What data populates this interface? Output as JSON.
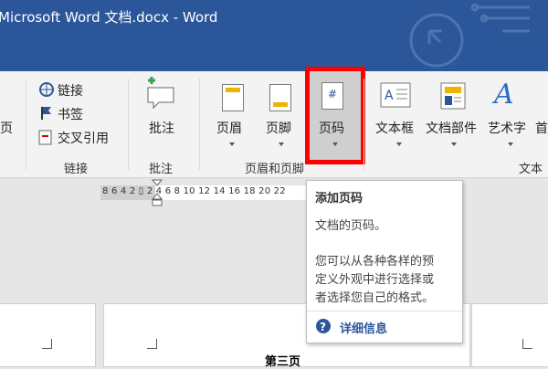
{
  "window": {
    "title": "Microsoft Word 文档.docx  -  Word"
  },
  "colors": {
    "accent": "#2b579a",
    "highlight": "#ff0000",
    "link": "#2b579a"
  },
  "ribbon": {
    "partial_left_label": "页",
    "links_group": {
      "items": [
        {
          "label": "链接",
          "icon": "link-icon"
        },
        {
          "label": "书签",
          "icon": "bookmark-flag-icon"
        },
        {
          "label": "交叉引用",
          "icon": "cross-reference-icon"
        }
      ],
      "group_label": "链接"
    },
    "comments_group": {
      "button_label": "批注",
      "group_label": "批注"
    },
    "header_footer_group": {
      "buttons": [
        {
          "label": "页眉",
          "icon": "header-icon"
        },
        {
          "label": "页脚",
          "icon": "footer-icon"
        },
        {
          "label": "页码",
          "icon": "page-number-icon",
          "glyph": "#"
        }
      ],
      "group_label": "页眉和页脚"
    },
    "text_group": {
      "buttons": [
        {
          "label": "文本框",
          "icon": "text-box-icon"
        },
        {
          "label": "文档部件",
          "icon": "quick-parts-icon"
        },
        {
          "label": "艺术字",
          "icon": "wordart-icon",
          "glyph": "A"
        },
        {
          "label": "首"
        }
      ],
      "group_label": "文本"
    }
  },
  "ruler": {
    "numbers": "8 6 4 2 ▯ 2 4 6 8 10 12 14 16 18 20 22"
  },
  "tooltip": {
    "title": "添加页码",
    "line1": "文档的页码。",
    "desc_lines": [
      "您可以从各种各样的预",
      "定义外观中进行选择或",
      "者选择您自己的格式。"
    ],
    "link_label": "详细信息",
    "help_icon": "help-circle-icon"
  },
  "document": {
    "page_text": "第三页"
  }
}
